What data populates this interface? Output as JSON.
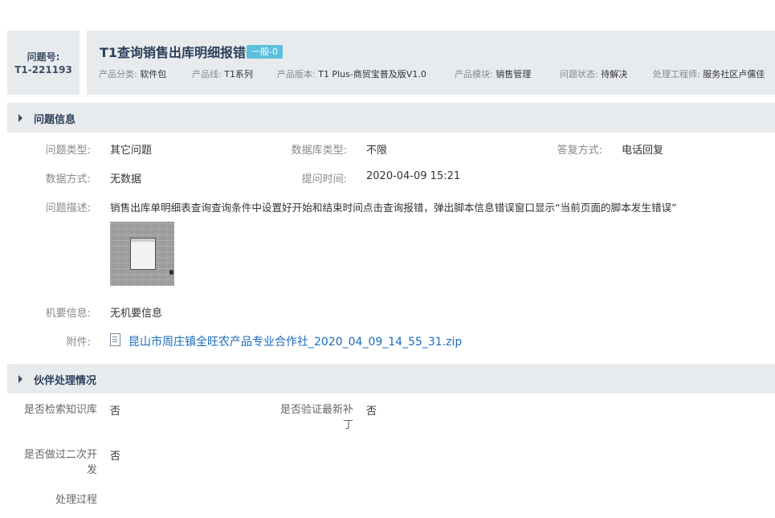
{
  "header": {
    "issue_label": "问题号:",
    "issue_number": "T1-221193",
    "title": "T1查询销售出库明细报错",
    "badge": "一般-0",
    "meta": [
      {
        "key": "产品分类:",
        "value": "软件包"
      },
      {
        "key": "产品线:",
        "value": "T1系列"
      },
      {
        "key": "产品版本:",
        "value": "T1 Plus-商贸宝普及版V1.0"
      },
      {
        "key": "产品模块:",
        "value": "销售管理"
      },
      {
        "key": "问题状态:",
        "value": "待解决"
      },
      {
        "key": "处理工程师:",
        "value": "服务社区卢儒佳"
      }
    ]
  },
  "section_issue": {
    "title": "问题信息",
    "problem_type_label": "问题类型:",
    "problem_type": "其它问题",
    "db_type_label": "数据库类型:",
    "db_type": "不限",
    "reply_label": "答复方式:",
    "reply": "电话回复",
    "data_mode_label": "数据方式:",
    "data_mode": "无数据",
    "time_label": "提问时间:",
    "time": "2020-04-09 15:21",
    "desc_label": "问题描述:",
    "desc": "销售出库单明细表查询查询条件中设置好开始和结束时间点击查询报错，弹出脚本信息错误窗口显示“当前页面的脚本发生错误”",
    "secret_label": "机要信息:",
    "secret": "无机要信息",
    "attach_label": "附件:",
    "attach_file": "昆山市周庄镇全旺农产品专业合作社_2020_04_09_14_55_31.zip"
  },
  "section_partner": {
    "title": "伙伴处理情况",
    "kb_label": "是否检索知识库",
    "kb": "否",
    "patch_label": "是否验证最新补丁",
    "patch": "否",
    "dev_label": "是否做过二次开发",
    "dev": "否",
    "process_label": "处理过程"
  }
}
